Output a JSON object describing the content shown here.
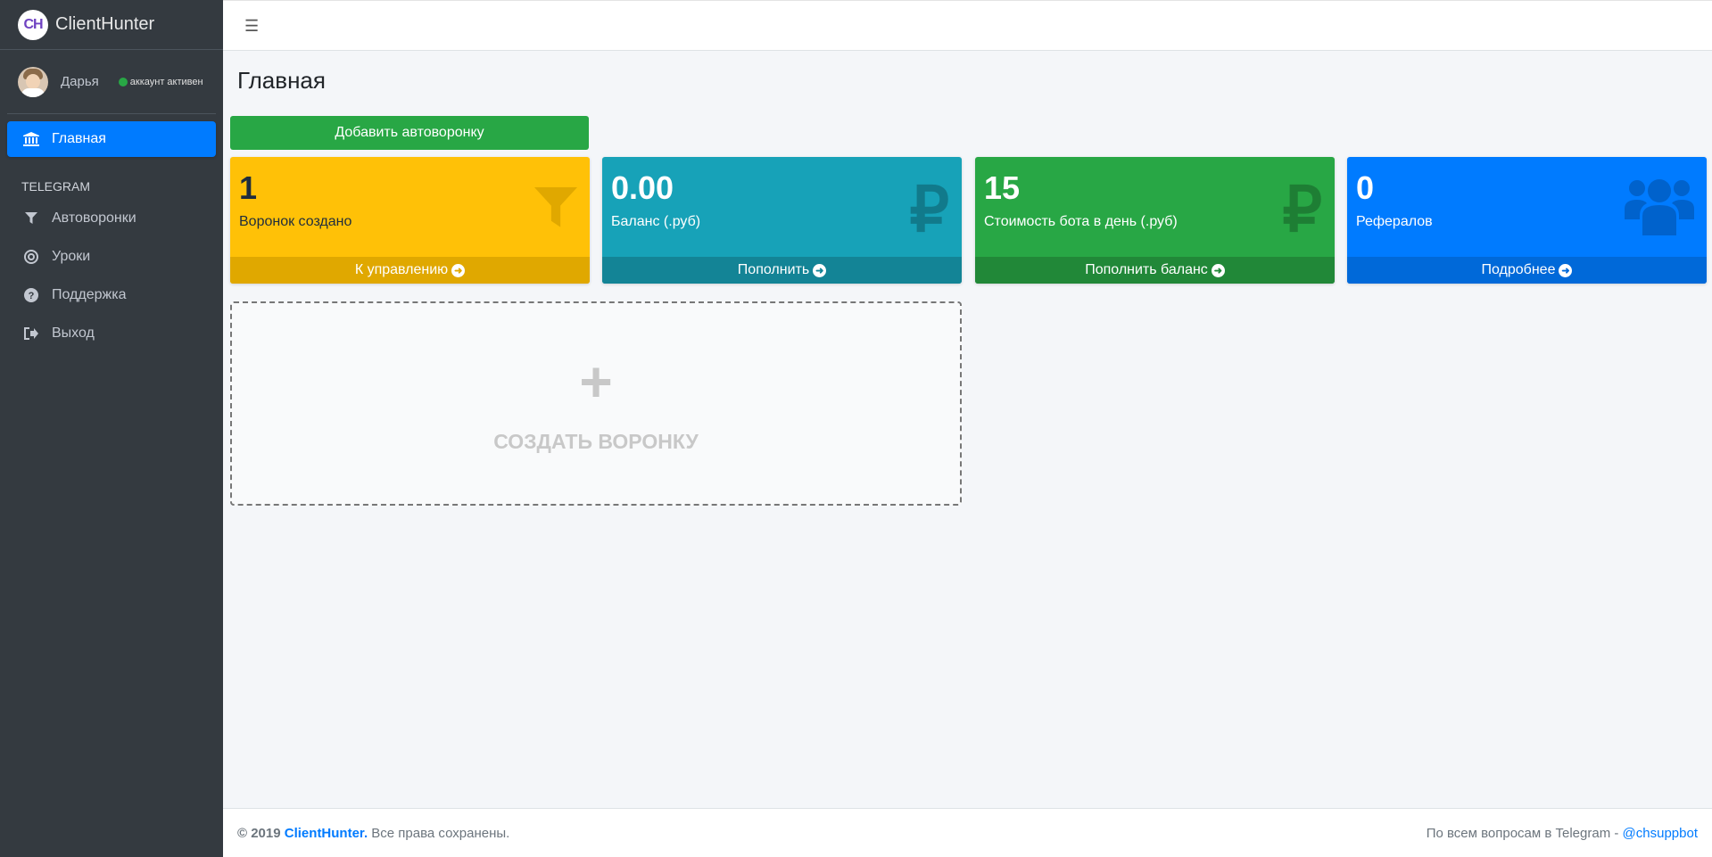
{
  "brand": {
    "logo": "CH",
    "name": "ClientHunter"
  },
  "user": {
    "name": "Дарья",
    "status": "аккаунт активен"
  },
  "nav": {
    "main": {
      "label": "Главная",
      "icon": "bank-icon"
    },
    "header": "TELEGRAM",
    "items": [
      {
        "label": "Автоворонки",
        "icon": "filter-icon"
      },
      {
        "label": "Уроки",
        "icon": "life-ring-icon"
      },
      {
        "label": "Поддержка",
        "icon": "question-icon"
      },
      {
        "label": "Выход",
        "icon": "sign-out-icon"
      }
    ]
  },
  "topbar": {
    "menu_icon": "hamburger-icon"
  },
  "page": {
    "title": "Главная",
    "add_button": "Добавить автоворонку"
  },
  "cards": [
    {
      "value": "1",
      "label": "Воронок создано",
      "footer": "К управлению",
      "icon": "filter-icon",
      "color": "#ffc107"
    },
    {
      "value": "0.00",
      "label": "Баланс (.руб)",
      "footer": "Пополнить",
      "icon": "ruble-icon",
      "color": "#17a2b8"
    },
    {
      "value": "15",
      "label": "Стоимость бота в день (.руб)",
      "footer": "Пополнить баланс",
      "icon": "ruble-icon",
      "color": "#28a745"
    },
    {
      "value": "0",
      "label": "Рефералов",
      "footer": "Подробнее",
      "icon": "users-icon",
      "color": "#007bff"
    }
  ],
  "create": {
    "plus": "+",
    "label": "СОЗДАТЬ ВОРОНКУ"
  },
  "footer": {
    "copyright_year": "© 2019",
    "brand": "ClientHunter.",
    "rights": "Все права сохранены.",
    "contact_text": "По всем вопросам в Telegram -",
    "contact_link": "@chsuppbot"
  }
}
